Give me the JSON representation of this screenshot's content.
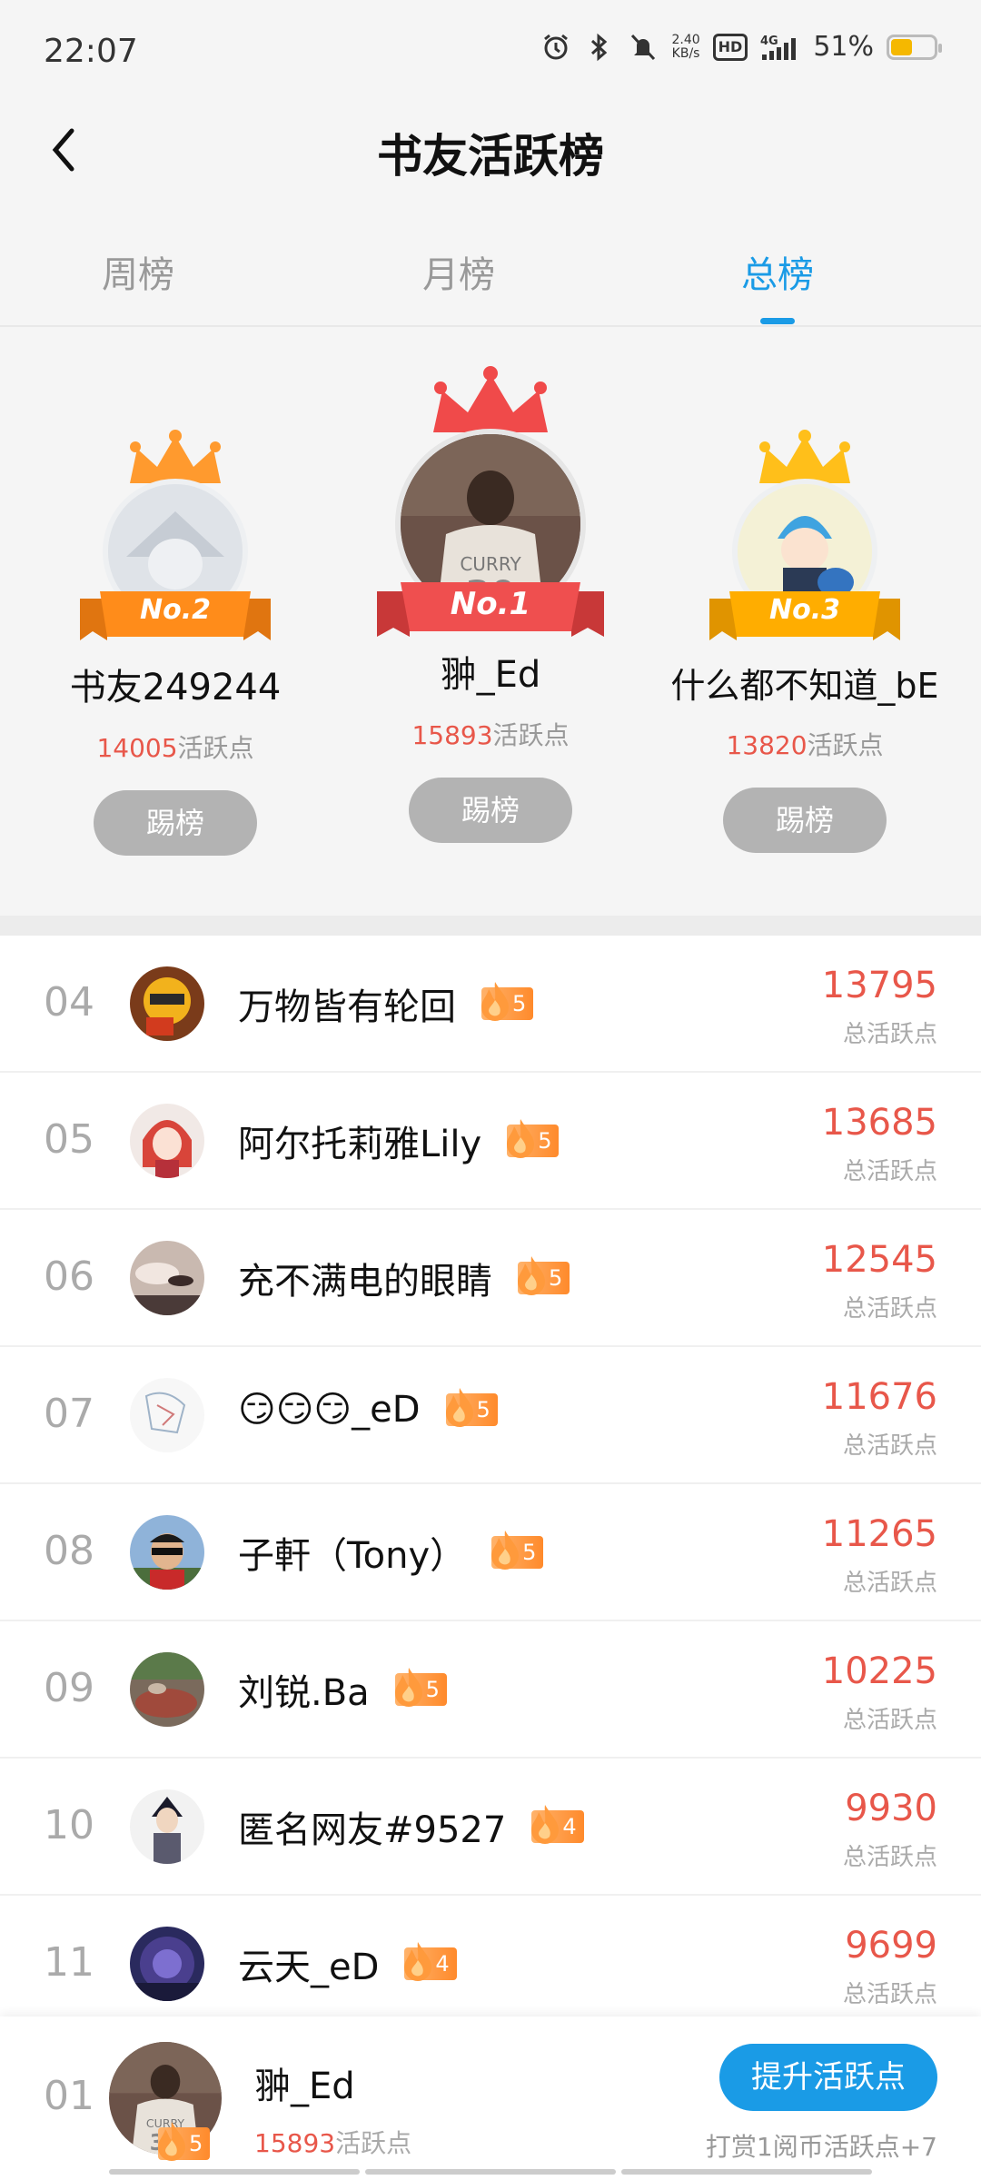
{
  "status_bar": {
    "time": "22:07",
    "net_speed": "2.40\nKB/s",
    "hd": "HD",
    "signal": "4G",
    "battery": "51%",
    "icons": [
      "alarm-icon",
      "bluetooth-icon",
      "mute-icon",
      "hd-icon",
      "signal-icon",
      "battery-icon"
    ]
  },
  "header": {
    "title": "书友活跃榜",
    "back_icon": "chevron-left-icon"
  },
  "tabs": [
    {
      "label": "周榜",
      "active": false
    },
    {
      "label": "月榜",
      "active": false
    },
    {
      "label": "总榜",
      "active": true
    }
  ],
  "podium": {
    "first": {
      "rank": "No.1",
      "name": "翀_Ed",
      "points": "15893",
      "unit": "活跃点",
      "button": "踢榜"
    },
    "second": {
      "rank": "No.2",
      "name": "书友249244",
      "points": "14005",
      "unit": "活跃点",
      "button": "踢榜"
    },
    "third": {
      "rank": "No.3",
      "name": "什么都不知道_bE",
      "points": "13820",
      "unit": "活跃点",
      "button": "踢榜"
    }
  },
  "list": [
    {
      "rank": "04",
      "name": "万物皆有轮回",
      "level": "5",
      "score": "13795",
      "label": "总活跃点"
    },
    {
      "rank": "05",
      "name": "阿尔托莉雅Lily",
      "level": "5",
      "score": "13685",
      "label": "总活跃点"
    },
    {
      "rank": "06",
      "name": "充不满电的眼睛",
      "level": "5",
      "score": "12545",
      "label": "总活跃点"
    },
    {
      "rank": "07",
      "name": "😏😏😏_eD",
      "level": "5",
      "score": "11676",
      "label": "总活跃点"
    },
    {
      "rank": "08",
      "name": "子軒（Tony）",
      "level": "5",
      "score": "11265",
      "label": "总活跃点"
    },
    {
      "rank": "09",
      "name": "刘锐.Ba",
      "level": "5",
      "score": "10225",
      "label": "总活跃点"
    },
    {
      "rank": "10",
      "name": "匿名网友#9527",
      "level": "4",
      "score": "9930",
      "label": "总活跃点"
    },
    {
      "rank": "11",
      "name": "云天_eD",
      "level": "4",
      "score": "9699",
      "label": "总活跃点"
    }
  ],
  "bottom_bar": {
    "rank": "01",
    "name": "翀_Ed",
    "level": "5",
    "points": "15893",
    "unit": "活跃点",
    "button": "提升活跃点",
    "tip": "打赏1阅币活跃点+7"
  },
  "colors": {
    "accent": "#1a9be6",
    "score": "#e8574a",
    "gold": "#f5b800",
    "first_ribbon": "#ef4f4f",
    "second_ribbon": "#ff8c1a",
    "third_ribbon": "#ffad00"
  }
}
